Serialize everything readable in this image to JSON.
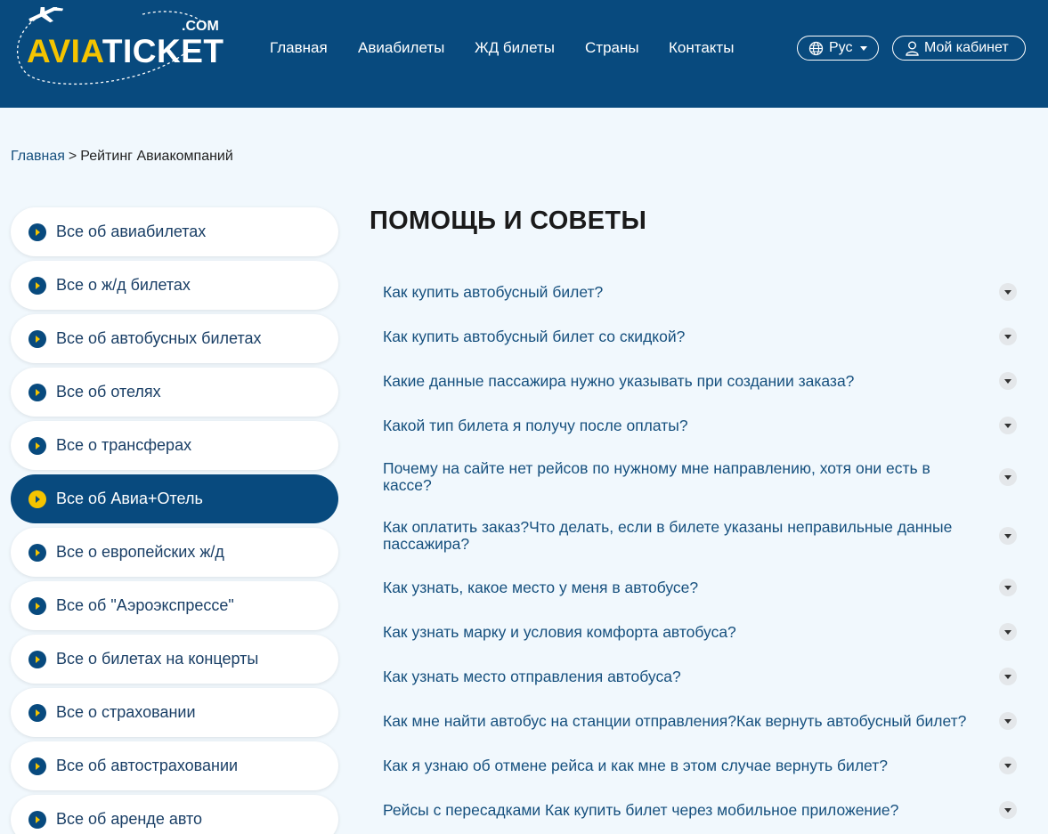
{
  "header": {
    "logo": {
      "brand_part1": "AVIA",
      "brand_part2": "TICKET",
      "domain": ".COM"
    },
    "nav": [
      {
        "label": "Главная"
      },
      {
        "label": "Авиабилеты"
      },
      {
        "label": "ЖД билеты"
      },
      {
        "label": "Страны"
      },
      {
        "label": "Контакты"
      }
    ],
    "language": {
      "label": "Рус",
      "icon": "globe-icon"
    },
    "account": {
      "label": "Мой кабинет",
      "icon": "user-icon"
    }
  },
  "breadcrumb": {
    "home": "Главная",
    "separator": ">",
    "current": "Рейтинг Авиакомпаний"
  },
  "sidebar": {
    "items": [
      {
        "label": "Все об авиабилетах",
        "active": false
      },
      {
        "label": "Все о ж/д билетах",
        "active": false
      },
      {
        "label": "Все об автобусных билетах",
        "active": false
      },
      {
        "label": "Все об отелях",
        "active": false
      },
      {
        "label": "Все о трансферах",
        "active": false
      },
      {
        "label": "Все об Авиа+Отель",
        "active": true
      },
      {
        "label": "Все о европейских ж/д",
        "active": false
      },
      {
        "label": "Все об \"Аэроэкспрессе\"",
        "active": false
      },
      {
        "label": "Все о билетах на концерты",
        "active": false
      },
      {
        "label": "Все о страховании",
        "active": false
      },
      {
        "label": "Все об автостраховании",
        "active": false
      },
      {
        "label": "Все об аренде авто",
        "active": false
      }
    ]
  },
  "main": {
    "title": "ПОМОЩЬ И СОВЕТЫ",
    "faq": [
      {
        "question": "Как купить автобусный билет?"
      },
      {
        "question": "Как купить автобусный билет со скидкой?"
      },
      {
        "question": "Какие данные пассажира нужно указывать при создании заказа?"
      },
      {
        "question": "Какой тип билета я получу после оплаты?"
      },
      {
        "question": "Почему на сайте нет рейсов по нужному мне направлению, хотя они есть в кассе?"
      },
      {
        "question": "Как оплатить заказ?Что делать, если в билете указаны неправильные данные пассажира?"
      },
      {
        "question": "Как узнать, какое место у меня в автобусе?"
      },
      {
        "question": "Как узнать марку и условия комфорта автобуса?"
      },
      {
        "question": "Как узнать место отправления автобуса?"
      },
      {
        "question": "Как мне найти автобус на станции отправления?Как вернуть автобусный билет?"
      },
      {
        "question": "Как я узнаю об отмене рейса и как мне в этом случае вернуть билет?"
      },
      {
        "question": "Рейсы с пересадками Как купить билет через мобильное приложение?"
      }
    ]
  },
  "colors": {
    "header_bg": "#084a7e",
    "accent_yellow": "#f5c400",
    "page_bg": "#f1f8fd",
    "link_blue": "#16507e"
  }
}
